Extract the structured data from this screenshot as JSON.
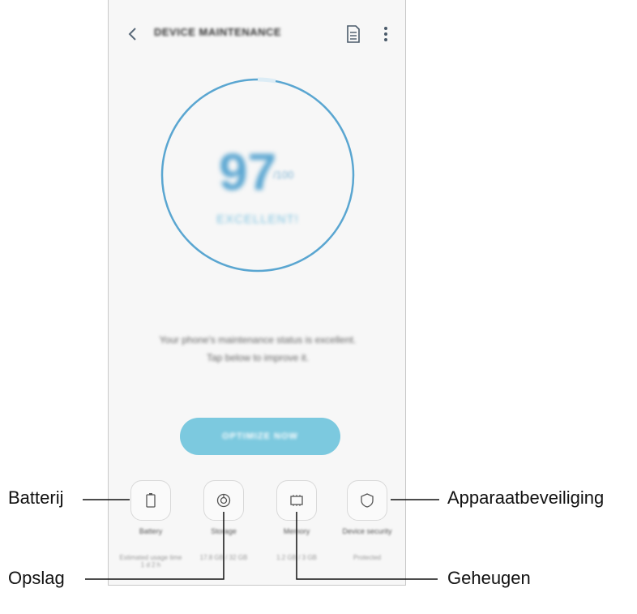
{
  "app": {
    "title": "DEVICE MAINTENANCE",
    "score": "97",
    "score_max": "/100",
    "status": "EXCELLENT!",
    "message_line1": "Your phone's maintenance status is excellent.",
    "message_line2": "Tap below to improve it.",
    "optimize_button": "OPTIMIZE NOW",
    "score_fraction": 0.97,
    "accent_color": "#7cc9df",
    "ring_color": "#5aa6d1"
  },
  "tiles": [
    {
      "label": "Battery",
      "sub": "Estimated usage time 1 d 2 h",
      "icon": "battery-icon"
    },
    {
      "label": "Storage",
      "sub": "17.8 GB / 32 GB",
      "icon": "storage-icon"
    },
    {
      "label": "Memory",
      "sub": "1.2 GB / 3 GB",
      "icon": "memory-icon"
    },
    {
      "label": "Device security",
      "sub": "Protected",
      "icon": "shield-icon"
    }
  ],
  "callouts": {
    "battery": "Batterij",
    "storage": "Opslag",
    "memory": "Geheugen",
    "security": "Apparaatbeveiliging"
  }
}
